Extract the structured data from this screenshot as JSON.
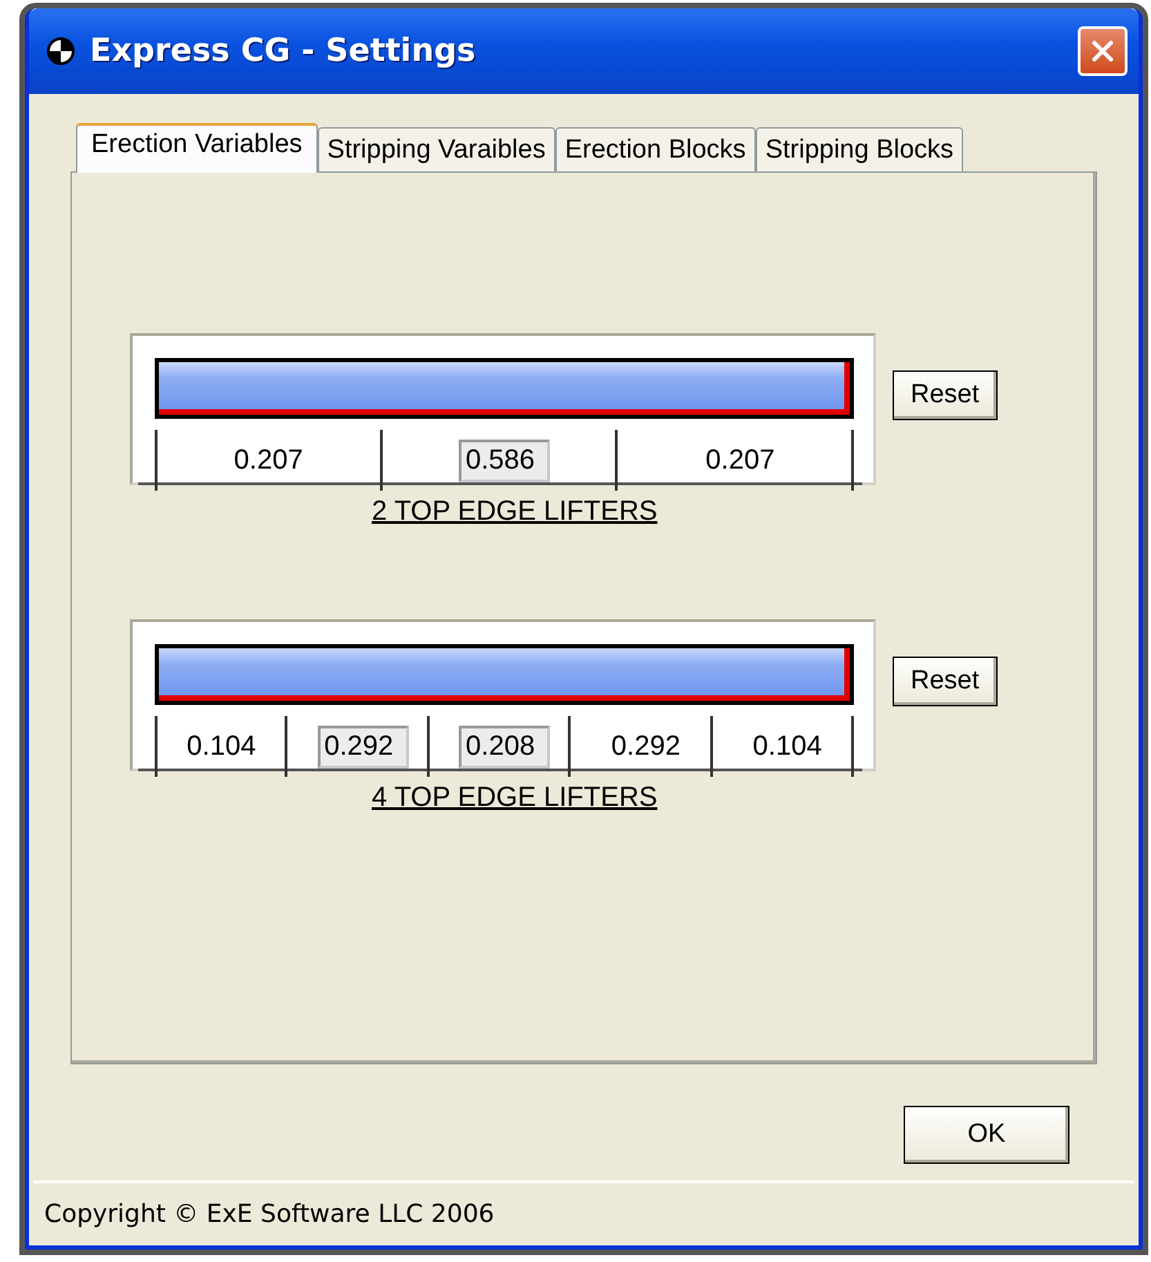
{
  "window": {
    "title": "Express CG - Settings"
  },
  "tabs": [
    {
      "label": "Erection Variables",
      "selected": true
    },
    {
      "label": "Stripping Varaibles",
      "selected": false
    },
    {
      "label": "Erection Blocks",
      "selected": false
    },
    {
      "label": "Stripping Blocks",
      "selected": false
    }
  ],
  "panels": [
    {
      "caption": "2 TOP EDGE LIFTERS",
      "reset": "Reset",
      "segments": [
        {
          "kind": "label",
          "value": "0.207"
        },
        {
          "kind": "field",
          "value": "0.586"
        },
        {
          "kind": "label",
          "value": "0.207"
        }
      ]
    },
    {
      "caption": "4 TOP EDGE LIFTERS",
      "reset": "Reset",
      "segments": [
        {
          "kind": "label",
          "value": "0.104"
        },
        {
          "kind": "field",
          "value": "0.292"
        },
        {
          "kind": "field",
          "value": "0.208"
        },
        {
          "kind": "label",
          "value": "0.292"
        },
        {
          "kind": "label",
          "value": "0.104"
        }
      ]
    }
  ],
  "buttons": [
    "OK"
  ],
  "status_bar": "Copyright © ExE Software LLC 2006"
}
